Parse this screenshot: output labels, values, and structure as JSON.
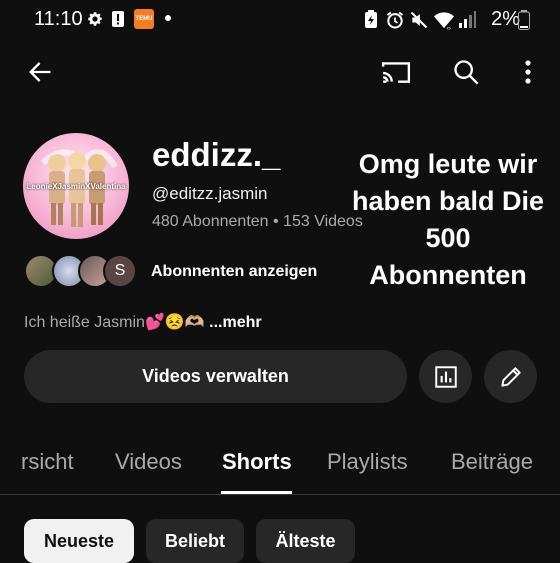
{
  "status_bar": {
    "time": "11:10",
    "battery": "2%",
    "app_badge": "TEMU",
    "left_icons": [
      "gear-icon",
      "alert-icon",
      "temu-app-icon",
      "dot-icon"
    ],
    "right_icons": [
      "battery-saver-icon",
      "alarm-icon",
      "mute-icon",
      "wifi-icon",
      "signal-icon",
      "battery-icon"
    ]
  },
  "top_bar": {
    "icons": [
      "back-arrow-icon",
      "cast-icon",
      "search-icon",
      "more-vert-icon"
    ]
  },
  "channel": {
    "avatar_caption": "LeonieXJasminXValentina",
    "name": "eddizz._",
    "handle": "@editzz.jasmin",
    "stats": "480 Abonnenten • 153 Videos",
    "overlay_text": "Omg leute wir haben bald Die 500 Abonnenten",
    "subscriber_avatar_letter": "S",
    "subscribers_link": "Abonnenten anzeigen",
    "description": "Ich heiße Jasmin💕😣🫶🏼",
    "description_more": "...mehr"
  },
  "actions": {
    "manage_videos": "Videos verwalten",
    "icons": [
      "analytics-icon",
      "edit-pencil-icon"
    ]
  },
  "tabs": [
    {
      "label": "rsicht",
      "active": false
    },
    {
      "label": "Videos",
      "active": false
    },
    {
      "label": "Shorts",
      "active": true
    },
    {
      "label": "Playlists",
      "active": false
    },
    {
      "label": "Beiträge",
      "active": false
    }
  ],
  "chips": [
    {
      "label": "Neueste",
      "selected": true
    },
    {
      "label": "Beliebt",
      "selected": false
    },
    {
      "label": "Älteste",
      "selected": false
    }
  ],
  "colors": {
    "background": "#0f0f0f",
    "surface": "#272727",
    "text_primary": "#f1f1f1",
    "text_secondary": "#aaaaaa",
    "temu_orange": "#f57c1f"
  }
}
